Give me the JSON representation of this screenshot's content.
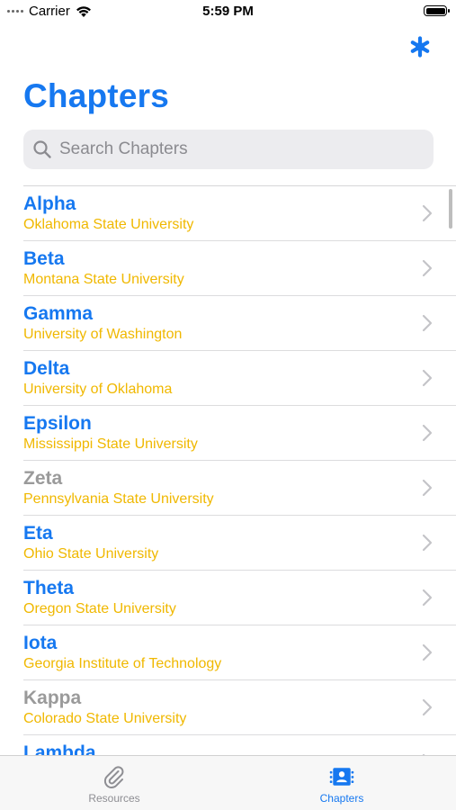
{
  "status_bar": {
    "carrier": "Carrier",
    "time": "5:59 PM",
    "battery_level": 1.0
  },
  "header": {
    "title": "Chapters",
    "settings_icon": "asterisk-icon"
  },
  "search": {
    "placeholder": "Search Chapters",
    "value": ""
  },
  "chapters": [
    {
      "name": "Alpha",
      "school": "Oklahoma State University",
      "active": true
    },
    {
      "name": "Beta",
      "school": "Montana State University",
      "active": true
    },
    {
      "name": "Gamma",
      "school": "University of Washington",
      "active": true
    },
    {
      "name": "Delta",
      "school": "University of Oklahoma",
      "active": true
    },
    {
      "name": "Epsilon",
      "school": "Mississippi State University",
      "active": true
    },
    {
      "name": "Zeta",
      "school": "Pennsylvania State University",
      "active": false
    },
    {
      "name": "Eta",
      "school": "Ohio State University",
      "active": true
    },
    {
      "name": "Theta",
      "school": "Oregon State University",
      "active": true
    },
    {
      "name": "Iota",
      "school": "Georgia Institute of Technology",
      "active": true
    },
    {
      "name": "Kappa",
      "school": "Colorado State University",
      "active": false
    },
    {
      "name": "Lambda",
      "school": "",
      "active": true
    }
  ],
  "tab_bar": {
    "resources_label": "Resources",
    "chapters_label": "Chapters",
    "selected": "Chapters"
  },
  "colors": {
    "accent": "#1678f0",
    "school_text": "#f0b800",
    "inactive": "#9a9a9a"
  }
}
